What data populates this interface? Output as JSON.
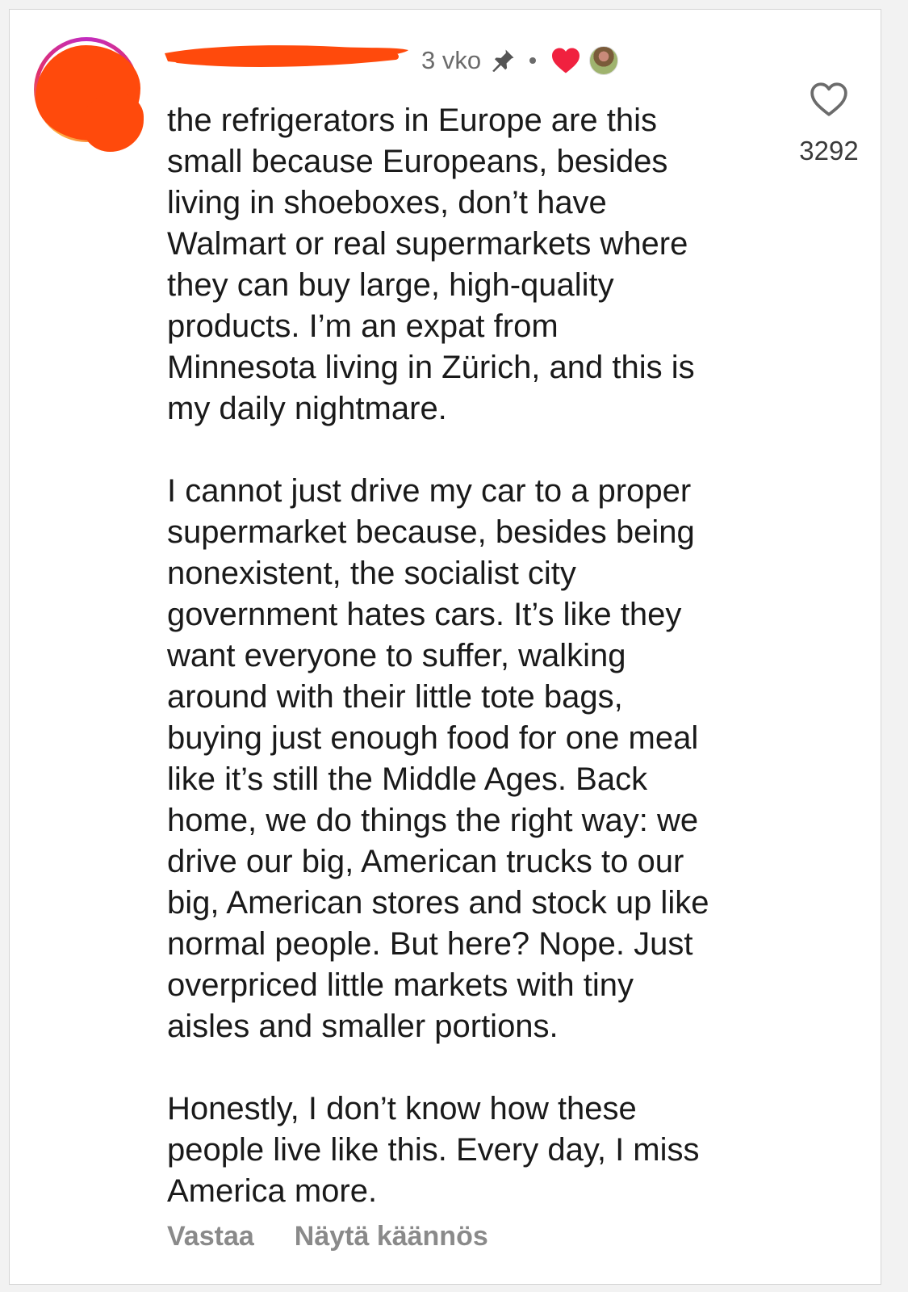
{
  "header": {
    "time": "3 vko",
    "icons": [
      "pin-icon",
      "heart-filled-icon"
    ],
    "heart_color": "#f0213f"
  },
  "comment": {
    "paragraphs": [
      "the refrigerators in Europe are this\nsmall because Europeans, besides\nliving in shoeboxes, don’t have\nWalmart or real supermarkets where\nthey can buy large, high-quality\nproducts. I’m an expat from\nMinnesota living in Zürich, and this is\nmy daily nightmare.",
      "I cannot just drive my car to a proper\nsupermarket because, besides being\nnonexistent, the socialist city\ngovernment hates cars. It’s like they\nwant everyone to suffer, walking\naround with their little tote bags,\nbuying just enough food for one meal\nlike it’s still the Middle Ages. Back\nhome, we do things the right way: we\ndrive our big, American trucks to our\nbig, American stores and stock up like\nnormal people. But here? Nope. Just\noverpriced little markets with tiny\naisles and smaller portions.",
      "Honestly, I don’t know how these\npeople live like this. Every day, I miss\nAmerica more."
    ]
  },
  "likes": {
    "count": "3292",
    "icon": "heart-outline-icon"
  },
  "actions": {
    "reply_label": "Vastaa",
    "translate_label": "Näytä käännös"
  },
  "colors": {
    "redaction": "#ff4a0c",
    "text": "#1a1a1a",
    "muted": "#8a8a8a"
  }
}
